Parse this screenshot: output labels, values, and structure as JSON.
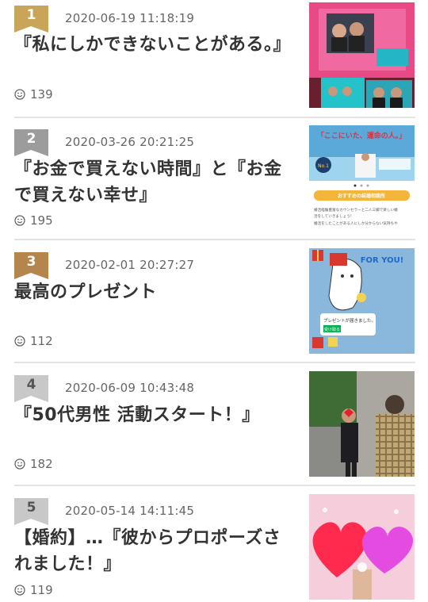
{
  "articles": [
    {
      "rank": "1",
      "rank_color": "#c9a55a",
      "date": "2020-06-19 11:18:19",
      "title": "『私にしかできないことがある。』",
      "likes": "139",
      "thumb_icon": "photo-cd-cases"
    },
    {
      "rank": "2",
      "rank_color": "#9c9c9c",
      "date": "2020-03-26 20:21:25",
      "title": "『お金で買えない時間』と『お金で買えない幸せ』",
      "likes": "195",
      "thumb_icon": "banner-website",
      "thumb_text": {
        "banner_title": "「ここにいた、運命の人。」",
        "badge": "No.1",
        "button": "おすすめの結婚相談所",
        "caption1": "婚活経験豊富なカウンセラーと二人三脚で楽しい婚",
        "caption2": "活をしていきましょう！",
        "caption3": "婚活をしたことがある人にしか分からない気持ちや"
      }
    },
    {
      "rank": "3",
      "rank_color": "#b5854e",
      "date": "2020-02-01 20:27:27",
      "title": "最高のプレゼント",
      "likes": "112",
      "thumb_icon": "chat-stickers",
      "thumb_text": {
        "sticker": "FOR YOU!",
        "message": "プレゼントが届きました。",
        "receive": "受け取る"
      }
    },
    {
      "rank": "4",
      "rank_color": "#c8c8c8",
      "date": "2020-06-09 10:43:48",
      "title": "『50代男性 活動スタート！』",
      "likes": "182",
      "thumb_icon": "photo-people"
    },
    {
      "rank": "5",
      "rank_color": "#c8c8c8",
      "date": "2020-05-14 14:11:45",
      "title": "【婚約】…『彼からプロポーズされました！』",
      "likes": "119",
      "thumb_icon": "photo-hearts"
    }
  ]
}
